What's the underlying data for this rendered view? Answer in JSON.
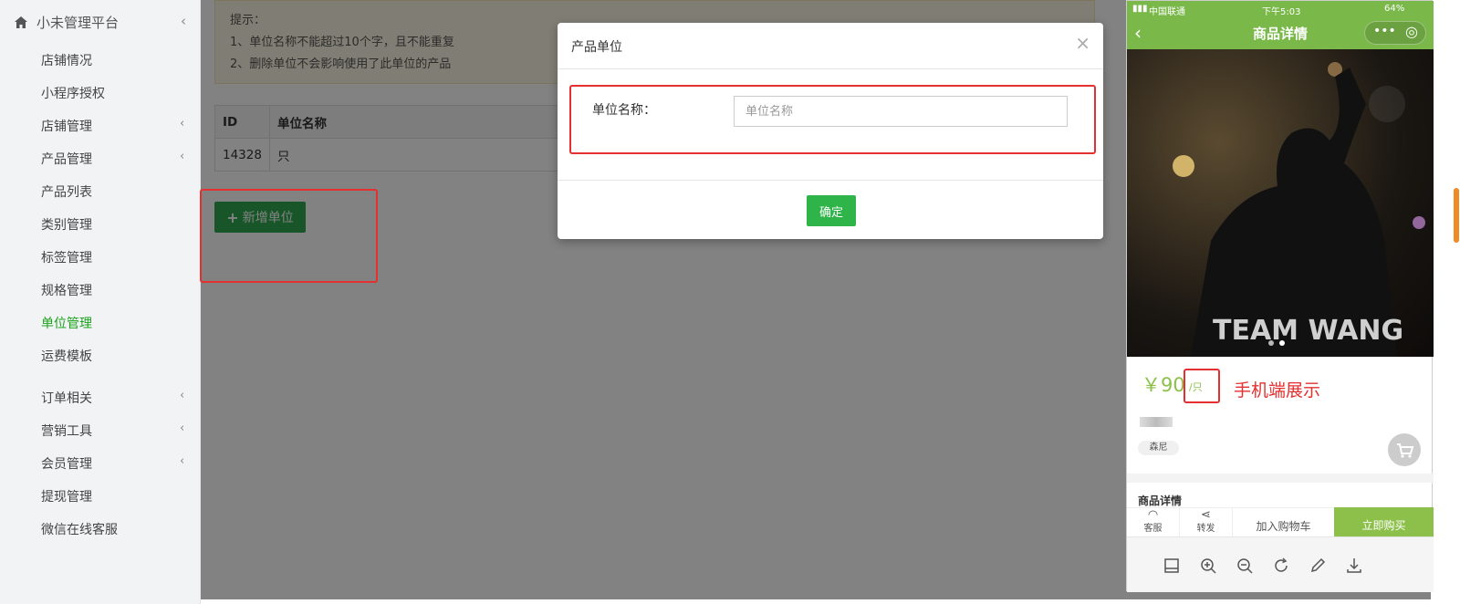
{
  "sidebar": {
    "brand": "小未管理平台",
    "items": [
      {
        "label": "店铺情况"
      },
      {
        "label": "小程序授权"
      },
      {
        "label": "店铺管理"
      },
      {
        "label": "产品管理"
      },
      {
        "label": "产品列表"
      },
      {
        "label": "类别管理"
      },
      {
        "label": "标签管理"
      },
      {
        "label": "规格管理"
      },
      {
        "label": "单位管理"
      },
      {
        "label": "运费模板"
      },
      {
        "label": "订单相关"
      },
      {
        "label": "营销工具"
      },
      {
        "label": "会员管理"
      },
      {
        "label": "提现管理"
      },
      {
        "label": "微信在线客服"
      }
    ]
  },
  "main": {
    "tip_title": "提示：",
    "tip_line1": "1、单位名称不能超过10个字，且不能重复",
    "tip_line2": "2、删除单位不会影响使用了此单位的产品",
    "table": {
      "headers": [
        "ID",
        "单位名称"
      ],
      "rows": [
        [
          "14328",
          "只"
        ]
      ]
    },
    "add_button": "新增单位"
  },
  "modal": {
    "title": "产品单位",
    "close": "×",
    "field_label": "单位名称：",
    "field_placeholder": "单位名称",
    "confirm": "确定"
  },
  "phone": {
    "carrier": "中国联通",
    "time": "下午5:03",
    "battery": "64%",
    "nav_title": "商品详情",
    "hero_text": "TEAM WANG",
    "price": "￥90",
    "unit": "/只",
    "annotation": "手机端展示",
    "tag": "森尼",
    "detail_title": "商品详情",
    "service": "客服",
    "share": "转发",
    "add_cart": "加入购物车",
    "buy_now": "立即购买"
  },
  "colors": {
    "accent_green": "#2fa84f",
    "phone_green": "#7ab84a",
    "highlight_red": "#e43030"
  }
}
